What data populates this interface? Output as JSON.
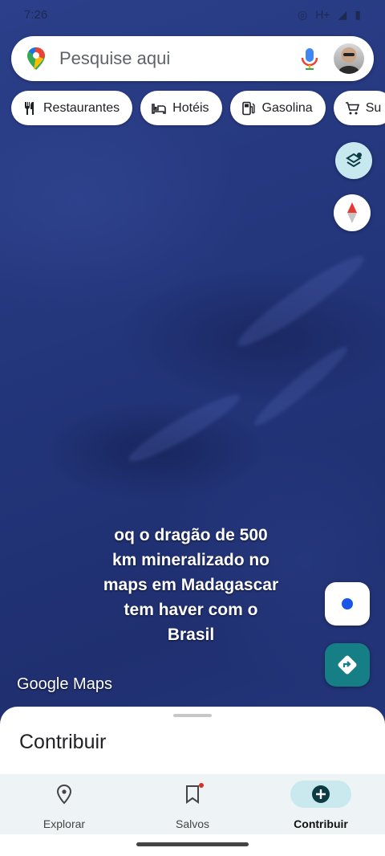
{
  "status_bar": {
    "time": "7:26",
    "network": "H+"
  },
  "search": {
    "placeholder": "Pesquise aqui"
  },
  "chips": [
    {
      "label": "Restaurantes",
      "icon": "fork-knife-icon"
    },
    {
      "label": "Hotéis",
      "icon": "bed-icon"
    },
    {
      "label": "Gasolina",
      "icon": "gas-station-icon"
    },
    {
      "label": "Su",
      "icon": "cart-icon"
    }
  ],
  "map": {
    "caption_lines": [
      "oq o dragão de 500",
      "km  mineralizado  no",
      "maps em Madagascar",
      "tem haver com o",
      "Brasil"
    ],
    "watermark": "Google Maps"
  },
  "sheet": {
    "title": "Contribuir"
  },
  "bottom_nav": [
    {
      "label": "Explorar",
      "icon": "location-pin-icon",
      "active": false
    },
    {
      "label": "Salvos",
      "icon": "bookmark-icon",
      "active": false
    },
    {
      "label": "Contribuir",
      "icon": "add-circle-icon",
      "active": true
    }
  ],
  "colors": {
    "ocean": "#23357a",
    "accent_teal": "#167f86",
    "active_nav": "#c9e9ee"
  }
}
